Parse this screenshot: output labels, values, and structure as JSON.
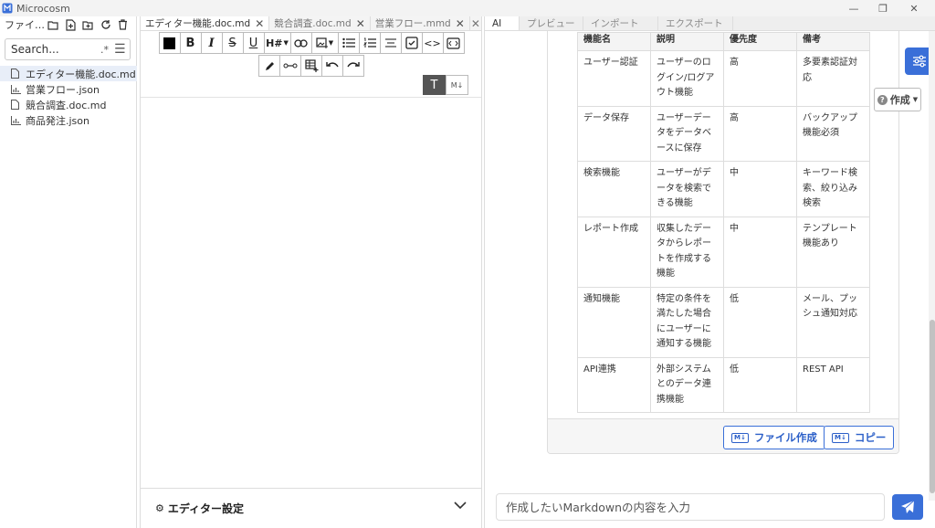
{
  "window": {
    "title": "Microcosm"
  },
  "sidebar": {
    "header_label": "ファイ…",
    "search_placeholder": "Search...",
    "files": [
      {
        "name": "エディター機能.doc.md",
        "icon": "file-icon",
        "active": true
      },
      {
        "name": "営業フロー.json",
        "icon": "chart-icon",
        "active": false
      },
      {
        "name": "競合調査.doc.md",
        "icon": "file-icon",
        "active": false
      },
      {
        "name": "商品発注.json",
        "icon": "chart-icon",
        "active": false
      }
    ]
  },
  "editor": {
    "tabs": [
      {
        "label": "エディター機能.doc.md",
        "active": true
      },
      {
        "label": "競合調査.doc.md",
        "active": false
      },
      {
        "label": "営業フロー.mmd",
        "active": false
      }
    ],
    "toolbar": {
      "bold": "B",
      "italic": "I",
      "strike": "S",
      "underline": "U",
      "heading": "H#",
      "code": "<>"
    },
    "mode": {
      "text": "T",
      "markdown": "M↓"
    },
    "settings_label": "エディター設定"
  },
  "right_panel": {
    "tabs": [
      "AI",
      "プレビュー",
      "インポート",
      "エクスポート"
    ],
    "table": {
      "headers": [
        "機能名",
        "説明",
        "優先度",
        "備考"
      ],
      "rows": [
        [
          "ユーザー認証",
          "ユーザーのログイン/ログアウト機能",
          "高",
          "多要素認証対応"
        ],
        [
          "データ保存",
          "ユーザーデータをデータベースに保存",
          "高",
          "バックアップ機能必須"
        ],
        [
          "検索機能",
          "ユーザーがデータを検索できる機能",
          "中",
          "キーワード検索、絞り込み検索"
        ],
        [
          "レポート作成",
          "収集したデータからレポートを作成する機能",
          "中",
          "テンプレート機能あり"
        ],
        [
          "通知機能",
          "特定の条件を満たした場合にユーザーに通知する機能",
          "低",
          "メール、プッシュ通知対応"
        ],
        [
          "API連携",
          "外部システムとのデータ連携機能",
          "低",
          "REST API"
        ]
      ]
    },
    "create_file_label": "ファイル作成",
    "copy_label": "コピー",
    "create_dropdown_label": "作成",
    "chat_placeholder": "作成したいMarkdownの内容を入力"
  },
  "colors": {
    "accent": "#3a6fd8"
  }
}
